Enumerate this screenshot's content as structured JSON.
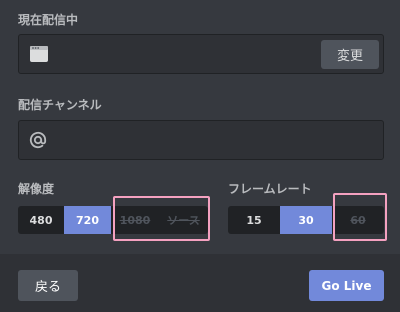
{
  "source": {
    "label": "現在配信中",
    "change_label": "変更",
    "icon": "window-icon"
  },
  "channel": {
    "label": "配信チャンネル",
    "icon": "at-icon"
  },
  "resolution": {
    "label": "解像度",
    "options": [
      {
        "label": "480",
        "state": "normal"
      },
      {
        "label": "720",
        "state": "selected"
      },
      {
        "label": "1080",
        "state": "disabled"
      },
      {
        "label": "ソース",
        "state": "disabled"
      }
    ]
  },
  "framerate": {
    "label": "フレームレート",
    "options": [
      {
        "label": "15",
        "state": "normal"
      },
      {
        "label": "30",
        "state": "selected"
      },
      {
        "label": "60",
        "state": "disabled"
      }
    ]
  },
  "footer": {
    "back_label": "戻る",
    "golive_label": "Go Live"
  },
  "colors": {
    "background": "#36393f",
    "accent": "#7289da",
    "highlight": "#f4a1c0"
  }
}
